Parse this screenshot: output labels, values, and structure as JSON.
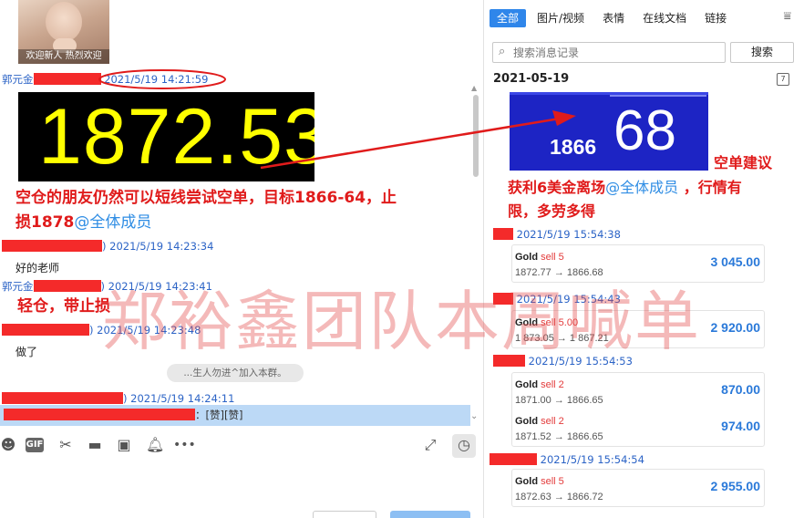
{
  "chat": {
    "avatar_caption": "欢迎新人 热烈欢迎",
    "messages": [
      {
        "sender_prefix": "郭元金",
        "timestamp": "2021/5/19 14:21:59"
      },
      {
        "timestamp": "2021/5/19 14:23:34",
        "text": "好的老师"
      },
      {
        "sender_prefix": "郭元金",
        "timestamp": "2021/5/19 14:23:41"
      },
      {
        "timestamp": "2021/5/19 14:23:48",
        "text": "做了"
      },
      {
        "timestamp": "2021/5/19 14:24:11"
      }
    ],
    "price_image_text": "1872.53",
    "note_line1": "空仓的朋友仍然可以短线尝试空单，目标1866-64，止",
    "note_line2": "损1878",
    "note_mention": "@全体成员",
    "note_small": "轻仓，带止损",
    "system_tip": "...生人勿进^加入本群。",
    "reply_suffix": "：[赞][赞]"
  },
  "toolbar": {
    "gif_label": "GIF"
  },
  "history": {
    "tabs": [
      {
        "label": "全部",
        "active": true
      },
      {
        "label": "图片/视频"
      },
      {
        "label": "表情"
      },
      {
        "label": "在线文档"
      },
      {
        "label": "链接"
      }
    ],
    "search_placeholder": "搜索消息记录",
    "search_button": "搜索",
    "date": "2021-05-19",
    "card_small": "1866",
    "card_big": "68",
    "side_note": "空单建议",
    "profit_note_a": "获利6美金离场",
    "profit_note_mention": "@全体成员",
    "profit_note_b": " ，行情有",
    "profit_note_line2": "限，多劳多得",
    "entries": [
      {
        "timestamp": "2021/5/19 15:54:38",
        "trades": [
          {
            "symbol": "Gold",
            "side": "sell 5",
            "path": "1872.77 → 1866.68",
            "profit": "3 045.00"
          }
        ]
      },
      {
        "timestamp": "2021/5/19 15:54:43",
        "trades": [
          {
            "symbol": "Gold",
            "side": "sell 5.00",
            "path": "1 873.05 → 1 867.21",
            "profit": "2 920.00"
          }
        ]
      },
      {
        "timestamp": "2021/5/19 15:54:53",
        "trades": [
          {
            "symbol": "Gold",
            "side": "sell 2",
            "path": "1871.00 → 1866.65",
            "profit": "870.00"
          },
          {
            "symbol": "Gold",
            "side": "sell 2",
            "path": "1871.52 → 1866.65",
            "profit": "974.00"
          }
        ]
      },
      {
        "timestamp": "2021/5/19 15:54:54",
        "trades": [
          {
            "symbol": "Gold",
            "side": "sell 5",
            "path": "1872.63 → 1866.72",
            "profit": "2 955.00"
          }
        ]
      }
    ]
  },
  "watermark": "郑裕鑫团队本周喊单",
  "colors": {
    "accent": "#2f86ea",
    "annotation_red": "#e01b1b",
    "redaction": "#f42a2a",
    "profit_blue": "#2a79d9",
    "price_yellow": "#ffff00"
  }
}
